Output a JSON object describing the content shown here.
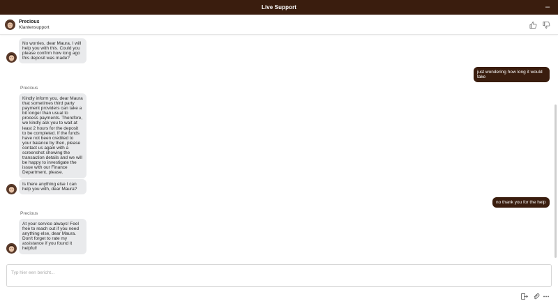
{
  "window": {
    "title": "Live Support",
    "minimize_symbol": "–"
  },
  "agent": {
    "name": "Precious",
    "role": "Klantensupport"
  },
  "feedback": {
    "thumb_up_icon": "thumbs-up-icon",
    "thumb_down_icon": "thumbs-down-icon"
  },
  "colors": {
    "brand": "#3a1d0e",
    "agent_bubble": "#e9eaec"
  },
  "messages": {
    "m1": {
      "from": "agent",
      "text": "No worries, dear Maura, I will help you with this. Could you please confirm how long ago this deposit was made?"
    },
    "m2": {
      "from": "user",
      "text": "just wondering how long it would take"
    },
    "m3_sender": "Precious",
    "m3": {
      "from": "agent",
      "text": "Kindly inform you, dear Maura that sometimes third party payment providers can take a bit longer than usual to process payments. Therefore, we kindly ask you to wait at least 2 hours for the deposit to be completed. If the funds have not been credited to your balance by then, please contact us again with a screenshot showing the transaction details and we will be happy to investigate the issue with our Finance Department, please."
    },
    "m4": {
      "from": "agent",
      "text": "Is there anything else I can help you with, dear Maura?"
    },
    "m5": {
      "from": "user",
      "text": "no thank you for the help"
    },
    "m6_sender": "Precious",
    "m6": {
      "from": "agent",
      "text": "At your service always! Feel free to reach out if you need anything else, dear Maura. Don't forget to rate my assistance if you found it helpful!"
    }
  },
  "composer": {
    "placeholder": "Typ hier een bericht...",
    "value": ""
  },
  "toolbar": {
    "icons": [
      "exit-icon",
      "paperclip-icon",
      "more-icon"
    ]
  }
}
